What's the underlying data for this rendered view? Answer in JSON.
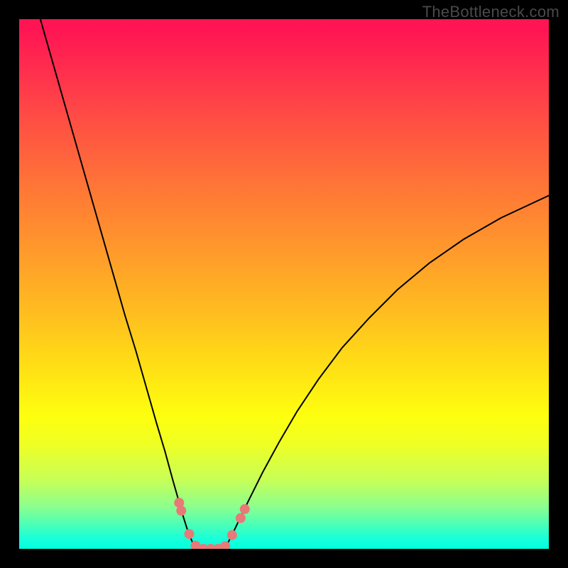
{
  "watermark": "TheBottleneck.com",
  "chart_data": {
    "type": "line",
    "title": "",
    "xlabel": "",
    "ylabel": "",
    "xlim": [
      0,
      100
    ],
    "ylim": [
      0,
      100
    ],
    "grid": false,
    "legend": false,
    "gradient_stops": [
      {
        "pos": 0,
        "color": "#ff1553"
      },
      {
        "pos": 2,
        "color": "#ff1553"
      },
      {
        "pos": 9,
        "color": "#ff2c4e"
      },
      {
        "pos": 20,
        "color": "#ff5143"
      },
      {
        "pos": 32,
        "color": "#ff7736"
      },
      {
        "pos": 44,
        "color": "#ff9a2b"
      },
      {
        "pos": 56,
        "color": "#ffbf1f"
      },
      {
        "pos": 68,
        "color": "#ffe713"
      },
      {
        "pos": 75,
        "color": "#fdff0f"
      },
      {
        "pos": 80,
        "color": "#f0ff22"
      },
      {
        "pos": 87,
        "color": "#c7ff56"
      },
      {
        "pos": 92,
        "color": "#8cff8e"
      },
      {
        "pos": 96,
        "color": "#40ffbf"
      },
      {
        "pos": 98,
        "color": "#1affd9"
      },
      {
        "pos": 100,
        "color": "#02ffe0"
      }
    ],
    "series": [
      {
        "name": "left-curve",
        "color": "#000000",
        "width": 2,
        "x": [
          4.0,
          6.0,
          8.0,
          10.0,
          12.0,
          14.0,
          16.0,
          18.0,
          20.0,
          22.0,
          24.0,
          26.0,
          27.5,
          29.0,
          30.0,
          31.0,
          31.8,
          32.6,
          33.2
        ],
        "y": [
          100.0,
          93.0,
          86.0,
          79.0,
          72.0,
          65.0,
          58.0,
          51.0,
          44.0,
          37.5,
          30.5,
          23.5,
          18.5,
          13.0,
          9.5,
          6.0,
          3.5,
          1.5,
          0.0
        ]
      },
      {
        "name": "flat-valley",
        "color": "#000000",
        "width": 2,
        "x": [
          33.2,
          34.0,
          35.0,
          36.0,
          37.0,
          38.0,
          38.8
        ],
        "y": [
          0.0,
          0.0,
          0.0,
          0.0,
          0.0,
          0.0,
          0.0
        ]
      },
      {
        "name": "right-curve",
        "color": "#000000",
        "width": 2,
        "x": [
          38.8,
          39.6,
          40.6,
          41.8,
          43.5,
          46.0,
          49.0,
          52.5,
          56.5,
          61.0,
          66.0,
          71.5,
          77.5,
          84.0,
          91.0,
          98.5,
          100.0
        ],
        "y": [
          0.0,
          1.5,
          3.5,
          6.0,
          9.5,
          14.5,
          20.0,
          26.0,
          32.0,
          38.0,
          43.5,
          49.0,
          54.0,
          58.5,
          62.5,
          66.0,
          66.7
        ]
      }
    ],
    "marker_series": {
      "name": "valley-dots",
      "color": "#e77a78",
      "radius": 7,
      "points": [
        {
          "x": 30.2,
          "y": 8.7
        },
        {
          "x": 30.6,
          "y": 7.2
        },
        {
          "x": 32.1,
          "y": 2.8
        },
        {
          "x": 33.3,
          "y": 0.6
        },
        {
          "x": 34.8,
          "y": 0.0
        },
        {
          "x": 36.2,
          "y": 0.0
        },
        {
          "x": 37.6,
          "y": 0.0
        },
        {
          "x": 38.9,
          "y": 0.5
        },
        {
          "x": 40.2,
          "y": 2.6
        },
        {
          "x": 41.8,
          "y": 5.8
        },
        {
          "x": 42.6,
          "y": 7.5
        }
      ]
    }
  }
}
